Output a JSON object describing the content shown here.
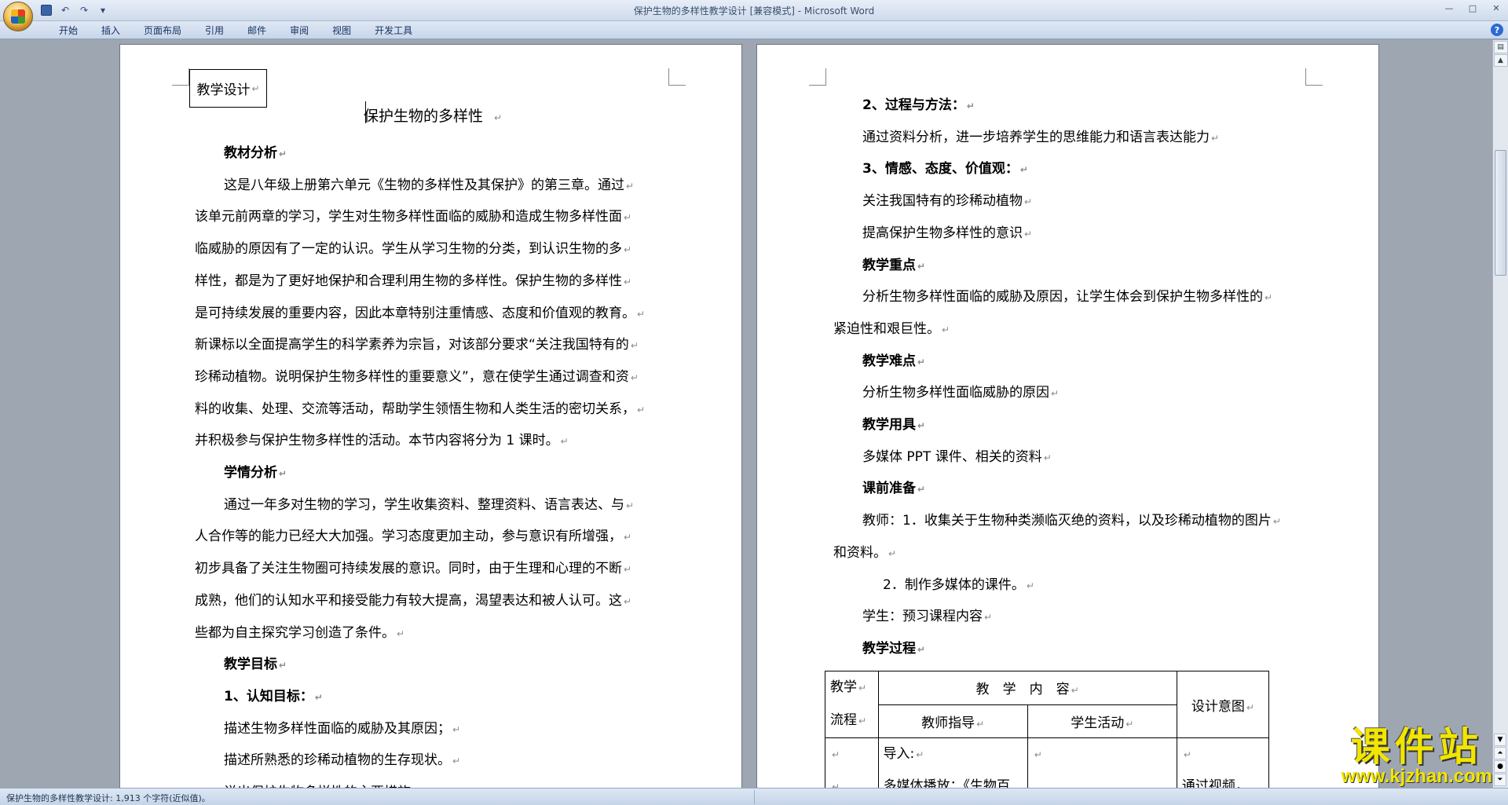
{
  "window": {
    "title": "保护生物的多样性教学设计 [兼容模式] - Microsoft Word",
    "controls": [
      "—",
      "□",
      "✕"
    ]
  },
  "qat": {
    "undo": "↶",
    "redo": "↷",
    "more": "▾"
  },
  "ribbon": {
    "tabs": [
      "开始",
      "插入",
      "页面布局",
      "引用",
      "邮件",
      "审阅",
      "视图",
      "开发工具"
    ],
    "help": "?"
  },
  "left_page": {
    "textbox": "教学设计",
    "title": "保护生物的多样性",
    "lines": [
      {
        "text": "教材分析",
        "bold": true,
        "indent": true
      },
      {
        "text": "这是八年级上册第六单元《生物的多样性及其保护》的第三章。通过",
        "bold": false,
        "indent": true
      },
      {
        "text": "该单元前两章的学习，学生对生物多样性面临的威胁和造成生物多样性面",
        "bold": false,
        "indent": false
      },
      {
        "text": "临威胁的原因有了一定的认识。学生从学习生物的分类，到认识生物的多",
        "bold": false,
        "indent": false
      },
      {
        "text": "样性，都是为了更好地保护和合理利用生物的多样性。保护生物的多样性",
        "bold": false,
        "indent": false
      },
      {
        "text": "是可持续发展的重要内容，因此本章特别注重情感、态度和价值观的教育。",
        "bold": false,
        "indent": false
      },
      {
        "text": "新课标以全面提高学生的科学素养为宗旨，对该部分要求“关注我国特有的",
        "bold": false,
        "indent": false
      },
      {
        "text": "珍稀动植物。说明保护生物多样性的重要意义”，意在使学生通过调查和资",
        "bold": false,
        "indent": false
      },
      {
        "text": "料的收集、处理、交流等活动，帮助学生领悟生物和人类生活的密切关系，",
        "bold": false,
        "indent": false
      },
      {
        "text": "并积极参与保护生物多样性的活动。本节内容将分为 1 课时。",
        "bold": false,
        "indent": false
      },
      {
        "text": "学情分析",
        "bold": true,
        "indent": true
      },
      {
        "text": "通过一年多对生物的学习，学生收集资料、整理资料、语言表达、与",
        "bold": false,
        "indent": true
      },
      {
        "text": "人合作等的能力已经大大加强。学习态度更加主动，参与意识有所增强，",
        "bold": false,
        "indent": false
      },
      {
        "text": "初步具备了关注生物圈可持续发展的意识。同时，由于生理和心理的不断",
        "bold": false,
        "indent": false
      },
      {
        "text": "成熟，他们的认知水平和接受能力有较大提高，渴望表达和被人认可。这",
        "bold": false,
        "indent": false
      },
      {
        "text": "些都为自主探究学习创造了条件。",
        "bold": false,
        "indent": false
      },
      {
        "text": "教学目标",
        "bold": true,
        "indent": true
      },
      {
        "text": "1、认知目标：",
        "bold": true,
        "indent": true
      },
      {
        "text": "描述生物多样性面临的威胁及其原因；",
        "bold": false,
        "indent": true
      },
      {
        "text": "描述所熟悉的珍稀动植物的生存现状。",
        "bold": false,
        "indent": true
      },
      {
        "text": "说出保护生物多样性的主要措施。",
        "bold": false,
        "indent": true
      }
    ]
  },
  "right_page": {
    "lines": [
      {
        "text": "2、过程与方法：",
        "bold": true,
        "indent": true
      },
      {
        "text": "通过资料分析，进一步培养学生的思维能力和语言表达能力",
        "bold": false,
        "indent": true
      },
      {
        "text": "3、情感、态度、价值观：",
        "bold": true,
        "indent": true
      },
      {
        "text": "关注我国特有的珍稀动植物",
        "bold": false,
        "indent": true
      },
      {
        "text": "提高保护生物多样性的意识",
        "bold": false,
        "indent": true
      },
      {
        "text": "教学重点",
        "bold": true,
        "indent": true
      },
      {
        "text": "分析生物多样性面临的威胁及原因，让学生体会到保护生物多样性的",
        "bold": false,
        "indent": true
      },
      {
        "text": "紧迫性和艰巨性。",
        "bold": false,
        "indent": false
      },
      {
        "text": "教学难点",
        "bold": true,
        "indent": true
      },
      {
        "text": "分析生物多样性面临威胁的原因",
        "bold": false,
        "indent": true
      },
      {
        "text": "教学用具",
        "bold": true,
        "indent": true
      },
      {
        "text": "多媒体 PPT 课件、相关的资料",
        "bold": false,
        "indent": true
      },
      {
        "text": "课前准备",
        "bold": true,
        "indent": true
      },
      {
        "text": "教师：1．收集关于生物种类濒临灭绝的资料，以及珍稀动植物的图片",
        "bold": false,
        "indent": true
      },
      {
        "text": "和资料。",
        "bold": false,
        "indent": false
      },
      {
        "text": "2．制作多媒体的课件。",
        "bold": false,
        "indent": "deep"
      },
      {
        "text": "学生：预习课程内容",
        "bold": false,
        "indent": true
      },
      {
        "text": "教学过程",
        "bold": true,
        "indent": true
      }
    ],
    "table": {
      "flow_1": "教学",
      "flow_2": "流程",
      "content_header": "教　学　内　容",
      "design_header": "设计意图",
      "teacher_header": "教师指导",
      "student_header": "学生活动",
      "row_intro": "导入:",
      "row_media": "多媒体播放：《生物百",
      "row_design": "通过视频，"
    }
  },
  "status": {
    "text": "保护生物的多样性教学设计: 1,913 个字符(近似值)。"
  },
  "watermark": {
    "title": "课件站",
    "url": "www.kjzhan.com"
  },
  "colors": {
    "ribbon_bg": "#dfe8f5",
    "workspace": "#9ea6b1",
    "watermark": "#f2e600"
  }
}
